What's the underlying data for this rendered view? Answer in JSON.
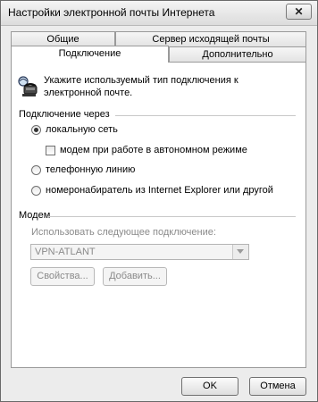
{
  "window": {
    "title": "Настройки электронной почты Интернета",
    "close_glyph": "✕"
  },
  "tabs": {
    "row1": [
      "Общие",
      "Сервер исходящей почты"
    ],
    "row2": [
      "Подключение",
      "Дополнительно"
    ],
    "active": "Подключение"
  },
  "intro": {
    "icon": "phone-computer-icon",
    "text_line1": "Укажите используемый тип подключения к",
    "text_line2": "электронной почте."
  },
  "connection": {
    "legend": "Подключение через",
    "options": {
      "lan": "локальную сеть",
      "offline": "модем при работе в автономном режиме",
      "phone": "телефонную линию",
      "dialer": "номеронабиратель из Internet Explorer или другой"
    },
    "selected": "lan",
    "offline_checked": false
  },
  "modem": {
    "legend": "Модем",
    "use_label": "Использовать следующее подключение:",
    "selected_connection": "VPN-ATLANT",
    "properties_label": "Свойства...",
    "add_label": "Добавить..."
  },
  "footer": {
    "ok_label": "OK",
    "cancel_label": "Отмена"
  }
}
